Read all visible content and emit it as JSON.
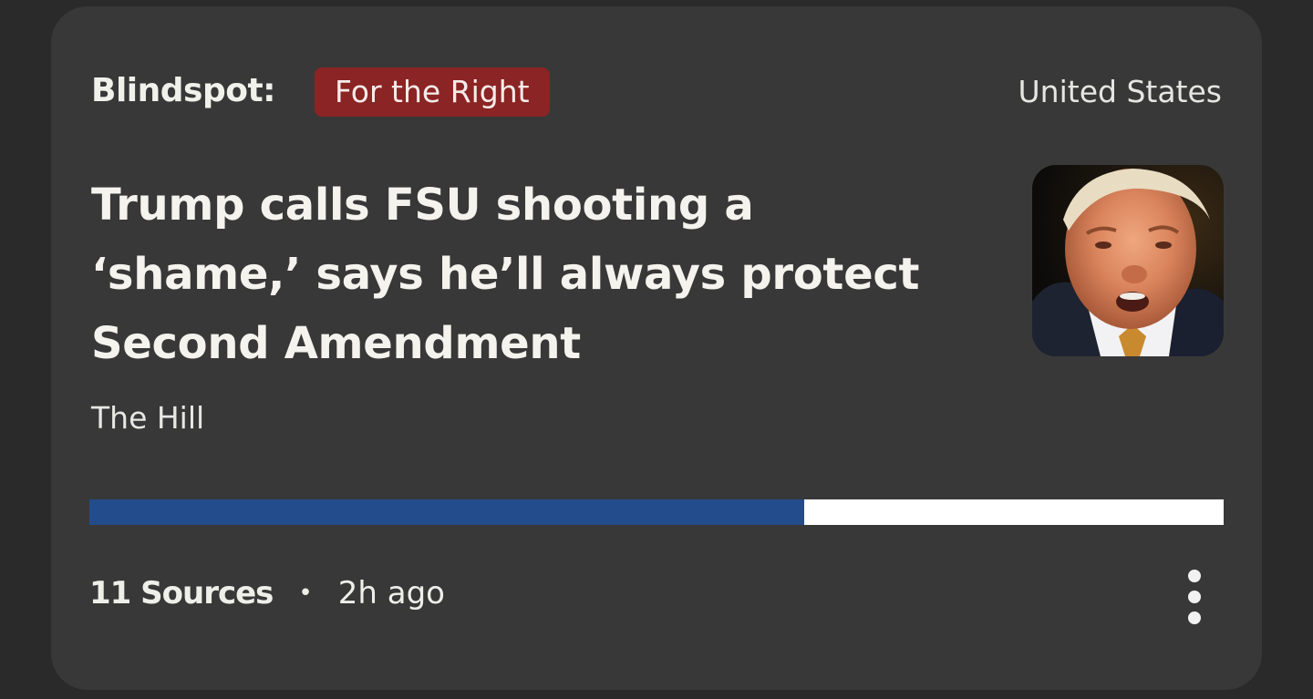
{
  "card": {
    "blindspot_label": "Blindspot:",
    "blindspot_tag": "For the Right",
    "region": "United States",
    "headline": "Trump calls FSU shooting a ‘shame,’ says he’ll always protect Second Amendment",
    "source_name": "The Hill",
    "thumbnail_icon": "news-photo-thumbnail",
    "bias": {
      "left_fraction": 0.63,
      "left_color": "#234c8c",
      "right_color": "#ffffff"
    },
    "footer": {
      "sources": "11 Sources",
      "separator": "•",
      "time": "2h ago"
    },
    "more_icon": "vertical-ellipsis-icon",
    "tag_color": "#8b2424"
  }
}
